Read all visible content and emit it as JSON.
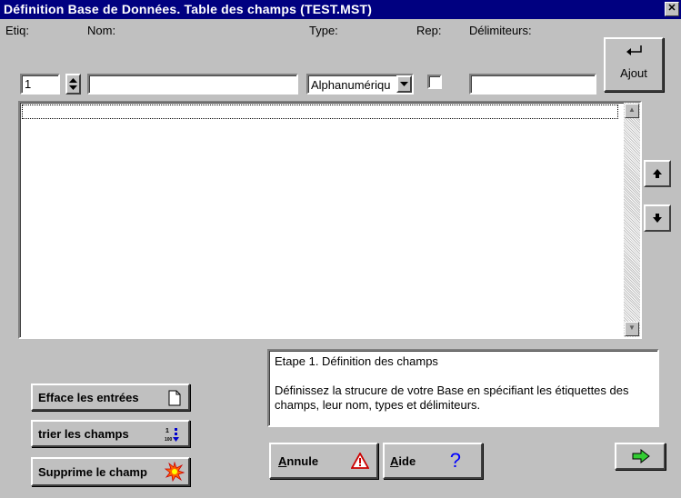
{
  "window": {
    "title": "Définition Base de Données. Table des champs (TEST.MST)",
    "close": "✕"
  },
  "labels": {
    "etiq": "Etiq:",
    "nom": "Nom:",
    "type": "Type:",
    "rep": "Rep:",
    "delimiteurs": "Délimiteurs:"
  },
  "inputs": {
    "etiq_value": "1",
    "nom_value": "",
    "type_selected": "Alphanumériqu",
    "rep_checked": false,
    "delimiteurs_value": ""
  },
  "buttons": {
    "ajout": "Ajout",
    "efface": "Efface les entrées",
    "trier": "trier les champs",
    "supprime": "Supprime le champ",
    "annule_first": "A",
    "annule_rest": "nnule",
    "aide_first": "A",
    "aide_rest": "ide",
    "aide_symbol": "?"
  },
  "info": {
    "line1": "Etape 1. Définition des champs",
    "line2": "Définissez la strucure de votre Base en spécifiant les étiquettes des champs, leur nom, types et délimiteurs."
  },
  "icons": [
    "close-icon",
    "spin-icon",
    "dropdown-arrow-icon",
    "enter-arrow-icon",
    "arrow-up-icon",
    "arrow-down-icon",
    "document-icon",
    "sort-icon",
    "explosion-icon",
    "warning-icon",
    "help-icon",
    "next-arrow-icon"
  ],
  "colors": {
    "titlebar": "#000080",
    "window": "#c0c0c0",
    "next_arrow": "#33cc33",
    "help": "#0000ff",
    "warning": "#cc0000"
  }
}
